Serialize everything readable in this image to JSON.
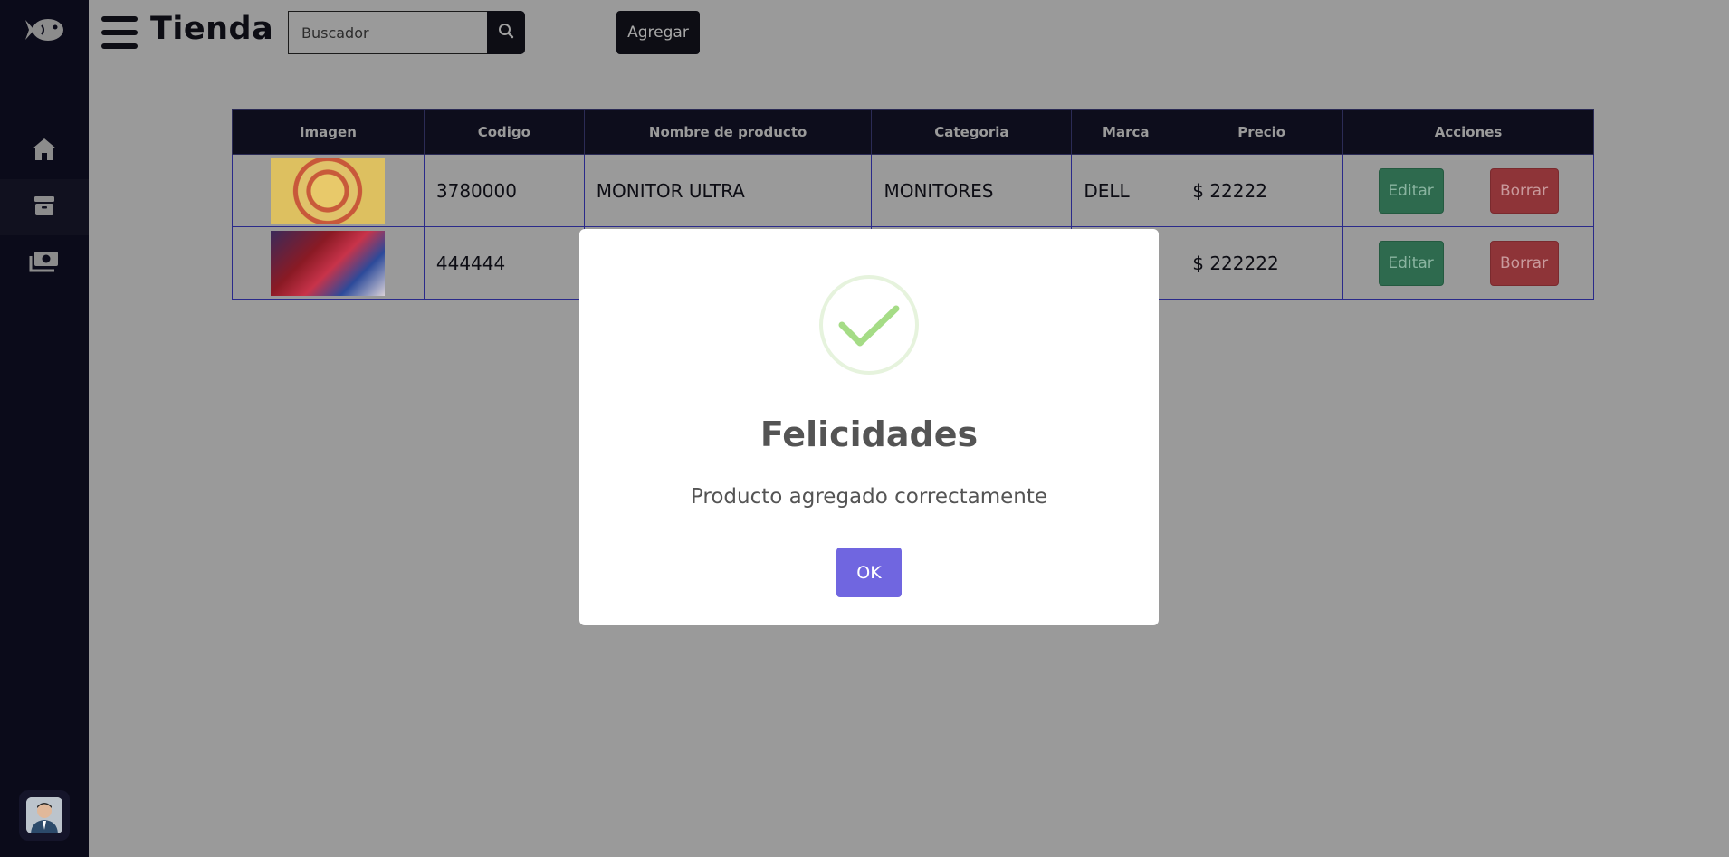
{
  "app": {
    "title": "Tienda"
  },
  "sidebar": {
    "logo_icon": "fish-icon",
    "items": [
      {
        "icon": "home-icon"
      },
      {
        "icon": "box-icon",
        "active": true
      },
      {
        "icon": "money-icon"
      }
    ],
    "avatar_icon": "user-avatar-icon"
  },
  "header": {
    "search_placeholder": "Buscador",
    "search_value": "",
    "add_label": "Agregar"
  },
  "table": {
    "headers": [
      "Imagen",
      "Codigo",
      "Nombre de producto",
      "Categoria",
      "Marca",
      "Precio",
      "Acciones"
    ],
    "rows": [
      {
        "codigo": "3780000",
        "nombre": "MONITOR ULTRA",
        "categoria": "MONITORES",
        "marca": "DELL",
        "precio": "$ 22222",
        "edit": "Editar",
        "delete": "Borrar"
      },
      {
        "codigo": "444444",
        "nombre": "",
        "categoria": "",
        "marca": "",
        "precio": "$ 222222",
        "edit": "Editar",
        "delete": "Borrar"
      }
    ]
  },
  "modal": {
    "icon": "success-check-icon",
    "title": "Felicidades",
    "text": "Producto agregado correctamente",
    "ok_label": "OK"
  },
  "colors": {
    "sidebar_bg": "#0b0b1a",
    "overlay_bg": "#9a9a9a",
    "edit_btn": "#2e6a4e",
    "delete_btn": "#8e3438",
    "ok_btn": "#7066e0",
    "check": "#a5dc86"
  }
}
